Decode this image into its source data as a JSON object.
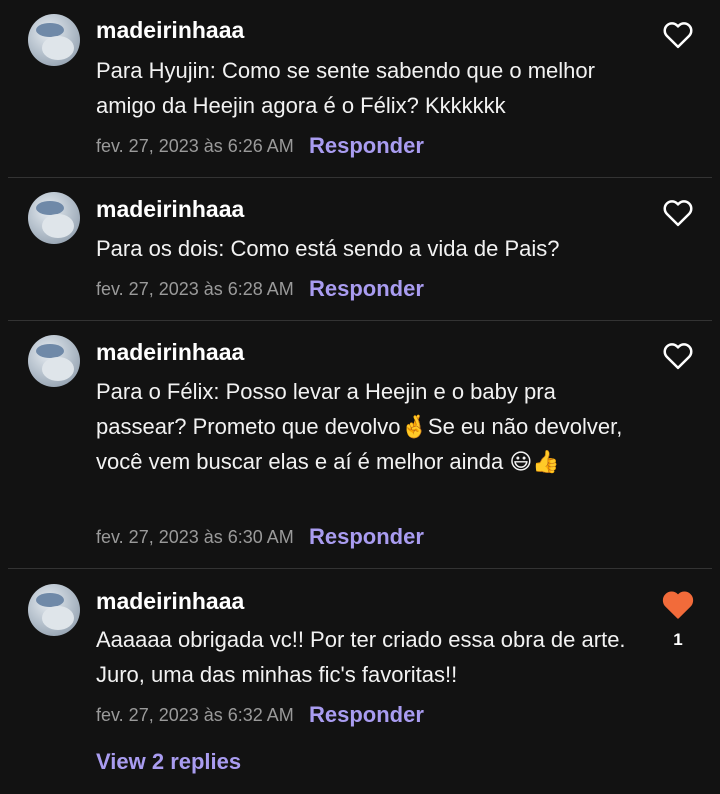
{
  "colors": {
    "background": "#121212",
    "accent": "#a99cf0",
    "heart_liked": "#f26b3a",
    "divider": "#333333",
    "meta": "#9a9a9a"
  },
  "comments": [
    {
      "username": "madeirinhaaa",
      "text": "Para Hyujin: Como se sente sabendo que o melhor amigo da Heejin agora é o Félix? Kkkkkkk",
      "timestamp": "fev. 27, 2023 às 6:26 AM",
      "reply_label": "Responder",
      "liked": false,
      "icon": "heart-outline-icon"
    },
    {
      "username": "madeirinhaaa",
      "text": "Para os dois: Como está sendo a vida de Pais?",
      "timestamp": "fev. 27, 2023 às 6:28 AM",
      "reply_label": "Responder",
      "liked": false,
      "icon": "heart-outline-icon"
    },
    {
      "username": "madeirinhaaa",
      "text": "Para o Félix: Posso levar a Heejin e o baby pra passear? Prometo que devolvo🤞Se eu não devolver, você vem buscar elas e aí é melhor ainda 😃👍",
      "timestamp": "fev. 27, 2023 às 6:30 AM",
      "reply_label": "Responder",
      "liked": false,
      "icon": "heart-outline-icon"
    },
    {
      "username": "madeirinhaaa",
      "text": "Aaaaaa obrigada vc!! Por ter criado essa obra de arte. Juro, uma das minhas fic's favoritas!!",
      "timestamp": "fev. 27, 2023 às 6:32 AM",
      "reply_label": "Responder",
      "liked": true,
      "like_count": "1",
      "icon": "heart-filled-icon"
    }
  ],
  "view_replies_label": "View 2 replies"
}
